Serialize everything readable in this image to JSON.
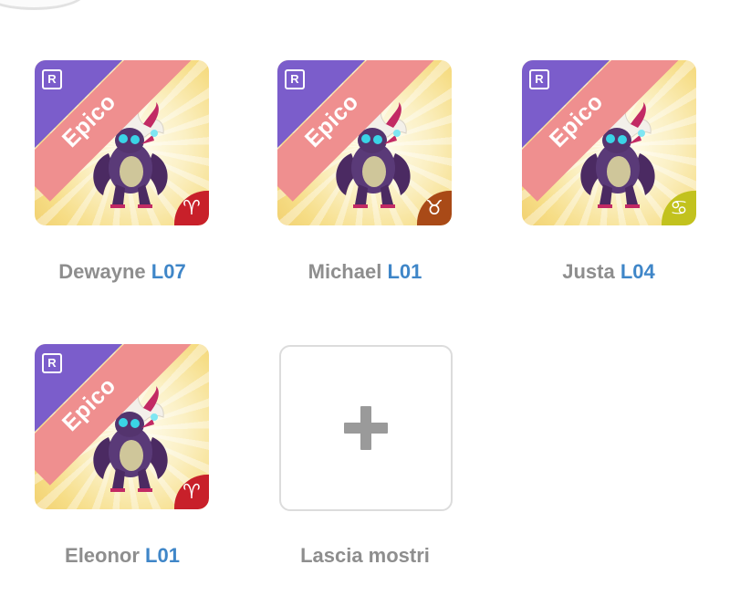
{
  "monsters": [
    {
      "rarity_label": "Epico",
      "badge": "R",
      "name": "Dewayne",
      "level": "L07",
      "zodiac_icon": "aries-icon",
      "zodiac_glyph": "♈",
      "zodiac_color": "#c8202a"
    },
    {
      "rarity_label": "Epico",
      "badge": "R",
      "name": "Michael",
      "level": "L01",
      "zodiac_icon": "taurus-icon",
      "zodiac_glyph": "♉",
      "zodiac_color": "#a94a17"
    },
    {
      "rarity_label": "Epico",
      "badge": "R",
      "name": "Justa",
      "level": "L04",
      "zodiac_icon": "cancer-icon",
      "zodiac_glyph": "♋",
      "zodiac_color": "#c2c21e"
    },
    {
      "rarity_label": "Epico",
      "badge": "R",
      "name": "Eleonor",
      "level": "L01",
      "zodiac_icon": "aries-icon",
      "zodiac_glyph": "♈",
      "zodiac_color": "#c8202a"
    }
  ],
  "add_slot": {
    "label": "Lascia mostri",
    "icon": "plus-icon"
  },
  "colors": {
    "rarity_ribbon": "#ef8f8f",
    "badge_corner": "#7b5dcb",
    "level_text": "#3f86c8",
    "name_text": "#8e8e8e"
  }
}
